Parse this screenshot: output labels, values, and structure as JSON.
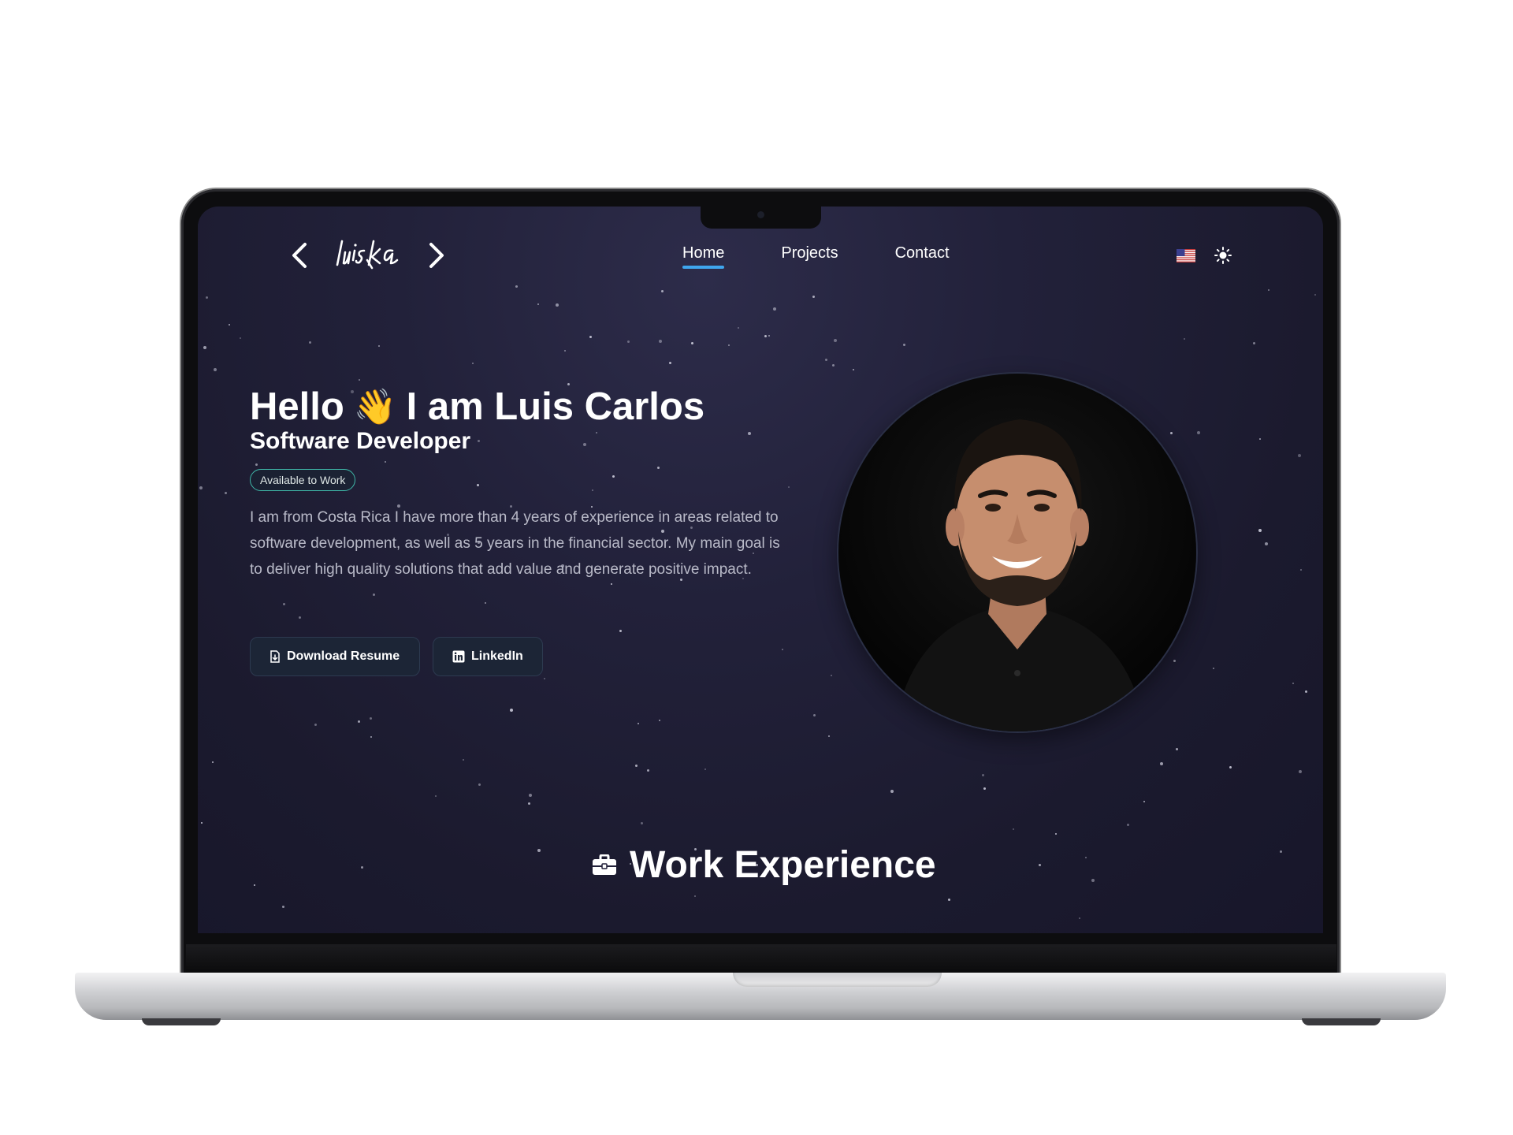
{
  "nav": {
    "logo_text": "luiska",
    "links": [
      {
        "label": "Home",
        "active": true
      },
      {
        "label": "Projects",
        "active": false
      },
      {
        "label": "Contact",
        "active": false
      }
    ],
    "language_icon": "us-flag-icon",
    "theme_icon": "sun-icon"
  },
  "hero": {
    "greeting": "Hello",
    "wave_emoji": "👋",
    "name_line": "I am Luis Carlos",
    "subtitle": "Software Developer",
    "badge": "Available to Work",
    "bio": "I am from Costa Rica I have more than 4 years of experience in areas related to software development, as well as 5 years in the financial sector. My main goal is to deliver high quality solutions that add value and generate positive impact.",
    "buttons": {
      "resume": "Download Resume",
      "linkedin": "LinkedIn"
    }
  },
  "section": {
    "heading": "Work Experience",
    "icon": "briefcase-icon"
  },
  "colors": {
    "background": "#1b1a2e",
    "accent": "#3fa6ee",
    "badge_border": "#3fb7a8",
    "button_bg": "#1c2536"
  }
}
